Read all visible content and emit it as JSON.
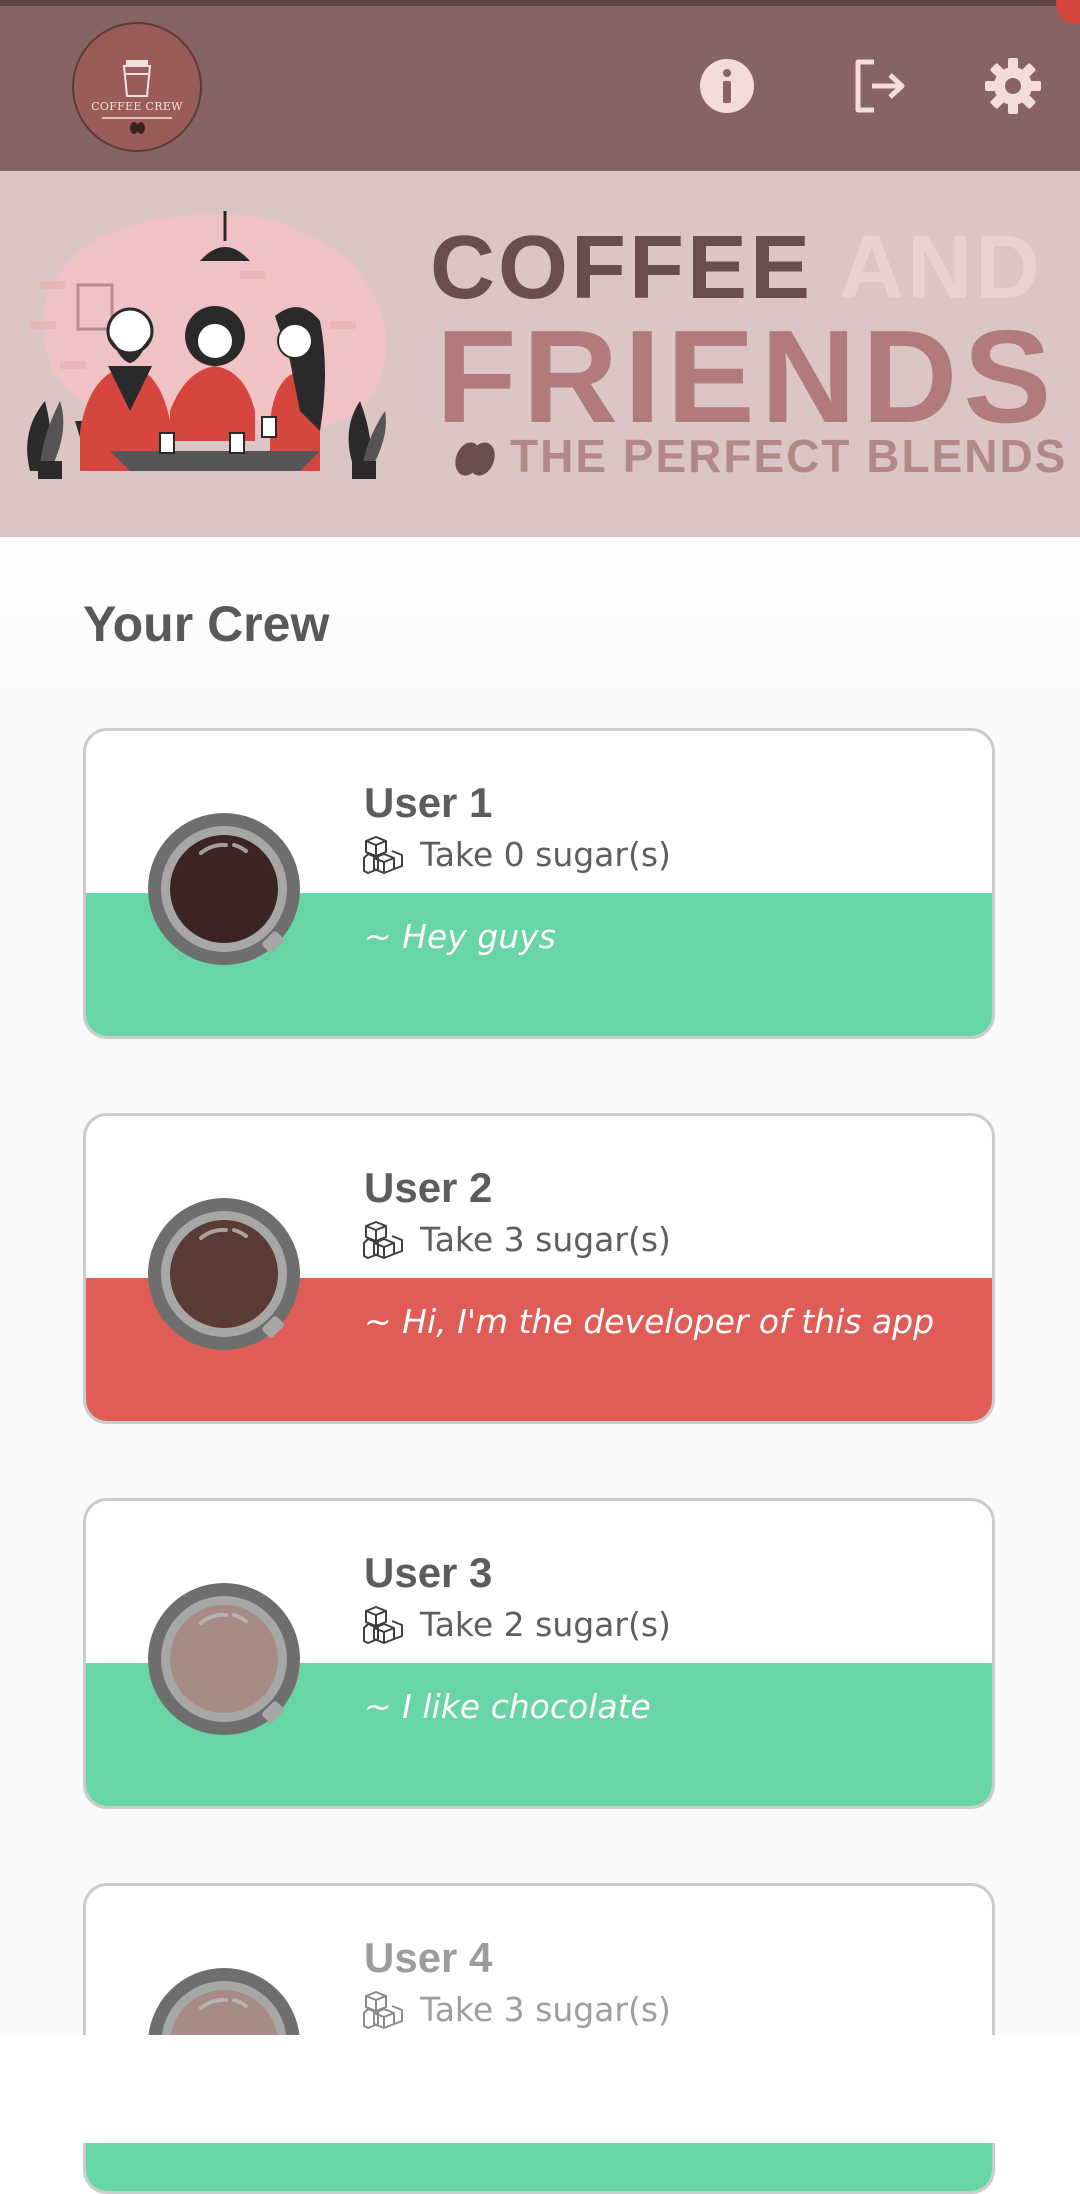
{
  "app": {
    "logo_text": "COFFEE CREW"
  },
  "appbar": {
    "icons": [
      "info-icon",
      "logout-icon",
      "gear-icon"
    ],
    "color": "#876462"
  },
  "banner": {
    "line1_word1": "COFFEE",
    "line1_word2": "AND",
    "line2": "FRIENDS",
    "line3": "THE PERFECT BLENDS"
  },
  "section": {
    "title": "Your Crew"
  },
  "crew": [
    {
      "name": "User 1",
      "sugar": "Take 0 sugar(s)",
      "status": "~ Hey guys",
      "band_color": "#68d5a4",
      "coffee_color": "#3d2424"
    },
    {
      "name": "User 2",
      "sugar": "Take 3 sugar(s)",
      "status": "~ Hi, I'm the developer of this app",
      "band_color": "#df5d56",
      "coffee_color": "#5a3b35"
    },
    {
      "name": "User 3",
      "sugar": "Take 2 sugar(s)",
      "status": "~ I like chocolate",
      "band_color": "#68d5a4",
      "coffee_color": "#a68b85"
    },
    {
      "name": "User 4",
      "sugar": "Take 3 sugar(s)",
      "status": "",
      "band_color": "#68d5a4",
      "coffee_color": "#a68b85"
    }
  ]
}
